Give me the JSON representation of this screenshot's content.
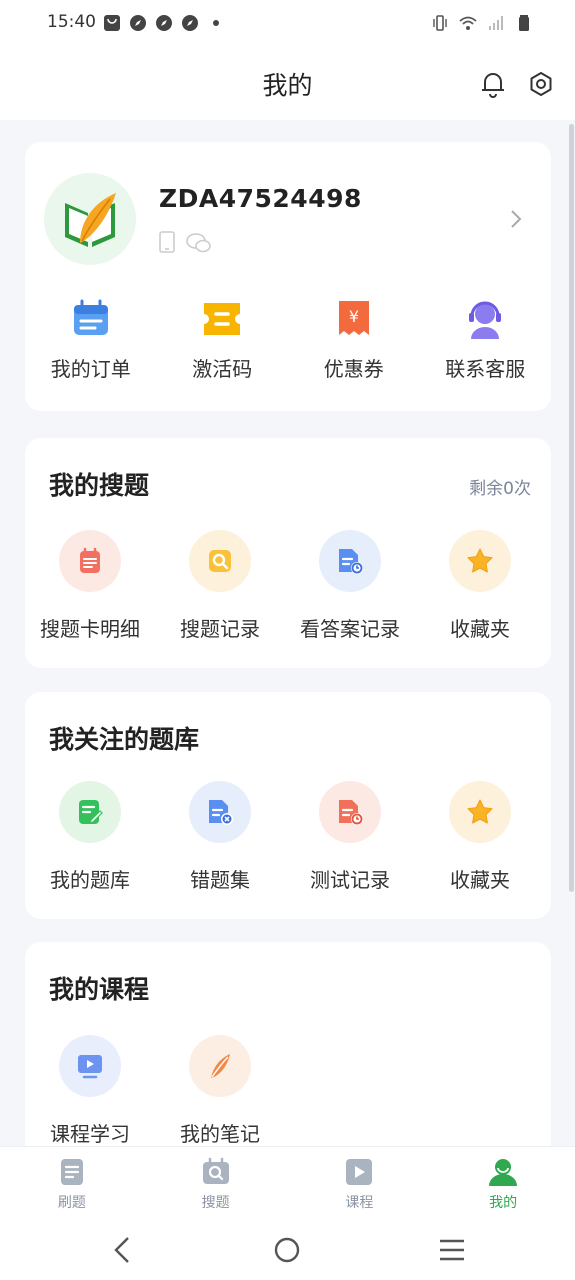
{
  "status_bar": {
    "time": "15:40",
    "left_icons": [
      "notification-bag-icon",
      "compass-icon",
      "compass-icon",
      "compass-icon",
      "dot-icon"
    ],
    "right_icons": [
      "vibrate-icon",
      "wifi-icon",
      "signal-icon",
      "battery-icon"
    ]
  },
  "header": {
    "title": "我的",
    "icons": [
      "bell-icon",
      "gear-icon"
    ]
  },
  "profile": {
    "username": "ZDA47524498",
    "quick_actions": [
      {
        "label": "我的订单",
        "icon": "order-calendar-icon"
      },
      {
        "label": "激活码",
        "icon": "ticket-icon"
      },
      {
        "label": "优惠券",
        "icon": "coupon-icon"
      },
      {
        "label": "联系客服",
        "icon": "customer-service-icon"
      }
    ]
  },
  "search_section": {
    "title": "我的搜题",
    "remaining": "剩余0次",
    "items": [
      {
        "label": "搜题卡明细",
        "icon": "search-card-detail-icon"
      },
      {
        "label": "搜题记录",
        "icon": "search-record-icon"
      },
      {
        "label": "看答案记录",
        "icon": "answer-record-icon"
      },
      {
        "label": "收藏夹",
        "icon": "star-icon"
      }
    ]
  },
  "bank_section": {
    "title": "我关注的题库",
    "items": [
      {
        "label": "我的题库",
        "icon": "question-bank-icon"
      },
      {
        "label": "错题集",
        "icon": "wrong-questions-icon"
      },
      {
        "label": "测试记录",
        "icon": "test-record-icon"
      },
      {
        "label": "收藏夹",
        "icon": "star-icon"
      }
    ]
  },
  "course_section": {
    "title": "我的课程",
    "items": [
      {
        "label": "课程学习",
        "icon": "video-course-icon"
      },
      {
        "label": "我的笔记",
        "icon": "feather-note-icon"
      }
    ]
  },
  "tabbar": {
    "tabs": [
      {
        "label": "刷题",
        "icon": "practice-icon"
      },
      {
        "label": "搜题",
        "icon": "search-tab-icon"
      },
      {
        "label": "课程",
        "icon": "course-play-icon"
      },
      {
        "label": "我的",
        "icon": "profile-icon",
        "active": true
      }
    ]
  },
  "colors": {
    "accent_green": "#2fa84f",
    "background": "#f4f6f9",
    "subtext": "#7a8599"
  }
}
